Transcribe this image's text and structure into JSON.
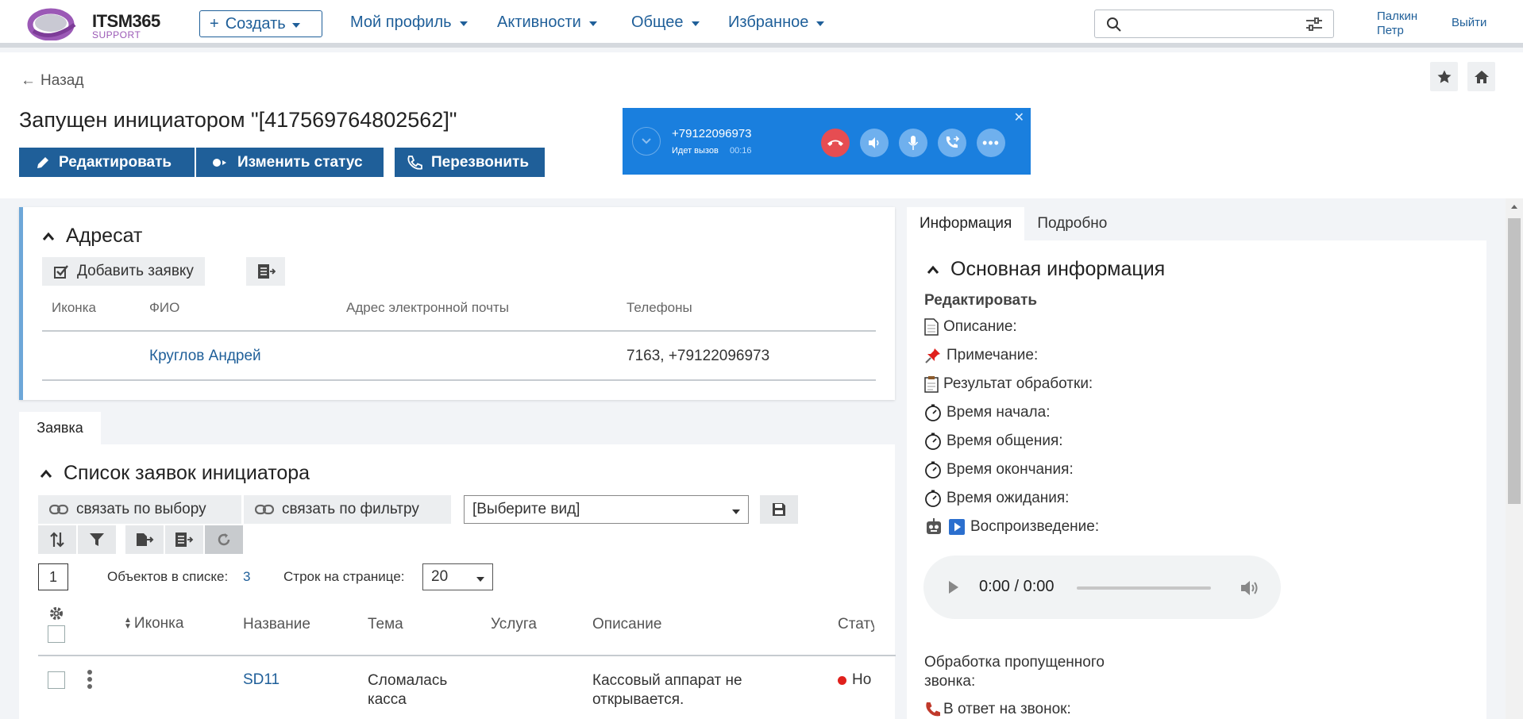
{
  "app": {
    "logo_main": "ITSM365",
    "logo_sub": "SUPPORT"
  },
  "topbar": {
    "create": "Создать",
    "nav": [
      "Мой профиль",
      "Активности",
      "Общее",
      "Избранное"
    ],
    "user_first": "Палкин",
    "user_last": "Петр",
    "logout": "Выйти",
    "search_placeholder": ""
  },
  "header": {
    "back": "Назад",
    "title": "Запущен инициатором \"[417569764802562]\"",
    "edit": "Редактировать",
    "change_status": "Изменить статус",
    "call_back": "Перезвонить"
  },
  "call": {
    "number": "+79122096973",
    "status": "Идет вызов",
    "time": "00:16"
  },
  "addressee": {
    "title": "Адресат",
    "add_request": "Добавить заявку",
    "columns": [
      "Иконка",
      "ФИО",
      "Адрес электронной почты",
      "Телефоны"
    ],
    "rows": [
      {
        "icon": "",
        "name": "Круглов Андрей",
        "email": "",
        "phones": "7163, +79122096973"
      }
    ]
  },
  "tab_request": "Заявка",
  "requests": {
    "title": "Список заявок инициатора",
    "link_selection": "связать по выбору",
    "link_filter": "связать по фильтру",
    "view_select": "[Выберите вид]",
    "page": "1",
    "count_label": "Объектов в списке:",
    "count": "3",
    "rows_label": "Строк на странице:",
    "rows_per_page": "20",
    "columns": [
      "Иконка",
      "Название",
      "Тема",
      "Услуга",
      "Описание",
      "Стату"
    ],
    "rows": [
      {
        "icon": "",
        "name": "SD11",
        "subject_1": "Сломалась",
        "subject_2": "касса",
        "service": "",
        "desc_1": "Кассовый аппарат не",
        "desc_2": "открывается.",
        "status": "Но",
        "status_color": "#e0201c"
      }
    ]
  },
  "right": {
    "tabs": [
      "Информация",
      "Подробно"
    ],
    "section_title": "Основная информация",
    "edit": "Редактировать",
    "fields": [
      "Описание:",
      "Примечание:",
      "Результат обработки:",
      "Время начала:",
      "Время общения:",
      "Время окончания:",
      "Время ожидания:",
      "Воспроизведение:"
    ],
    "audio_time": "0:00 / 0:00",
    "missed_1": "Обработка пропущенного",
    "missed_2": "звонка:",
    "reply": "В ответ на звонок:"
  },
  "colors": {
    "primary": "#1f5f99",
    "call_bg": "#1a7fde",
    "hangup": "#e64d52"
  }
}
